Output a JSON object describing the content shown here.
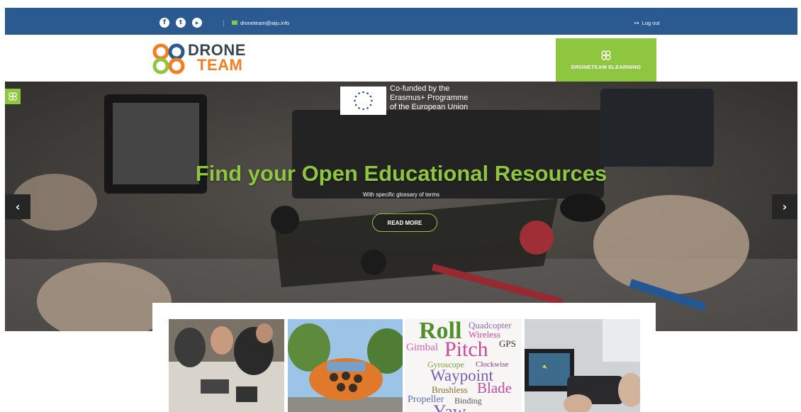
{
  "topbar": {
    "social_icons": [
      {
        "name": "facebook-icon",
        "glyph": "f"
      },
      {
        "name": "twitter-icon",
        "glyph": "t"
      },
      {
        "name": "youtube-icon",
        "glyph": "▶"
      }
    ],
    "email": "droneteam@aiju.info",
    "logout_label": "Log out",
    "background_color": "#2a5a90"
  },
  "logo": {
    "line1": "DRONE",
    "line2": "TEAM"
  },
  "elearning_button": {
    "label": "DRONETEAM ELEARNING",
    "color": "#8ec63f"
  },
  "hero": {
    "eu_lines": [
      "Co-funded by the",
      "Erasmus+ Programme",
      "of the European Union"
    ],
    "title": "Find your Open Educational Resources",
    "subtitle": "With specific glossary of terms",
    "button_label": "READ MORE",
    "prev_glyph": "‹",
    "next_glyph": "›",
    "accent_color": "#8ec63f"
  },
  "wordcloud": {
    "roll": "Roll",
    "quadcopter": "Quadcopter",
    "wireless": "Wireless",
    "gimbal": "Gimbal",
    "pitch": "Pitch",
    "gps": "GPS",
    "gyroscope": "Gyroscope",
    "clockwise": "Clockwise",
    "waypoint": "Waypoint",
    "brushless": "Brushless",
    "blade": "Blade",
    "propeller": "Propeller",
    "binding": "Binding",
    "yaw": "Yaw"
  }
}
